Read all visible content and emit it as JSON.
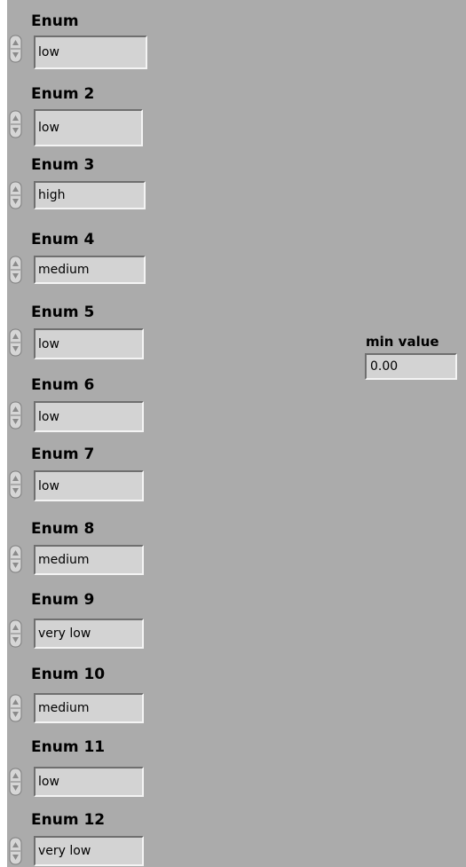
{
  "enums": [
    {
      "label": "Enum",
      "value": "low"
    },
    {
      "label": "Enum 2",
      "value": "low"
    },
    {
      "label": "Enum 3",
      "value": "high"
    },
    {
      "label": "Enum 4",
      "value": "medium"
    },
    {
      "label": "Enum 5",
      "value": "low"
    },
    {
      "label": "Enum 6",
      "value": "low"
    },
    {
      "label": "Enum 7",
      "value": "low"
    },
    {
      "label": "Enum 8",
      "value": "medium"
    },
    {
      "label": "Enum 9",
      "value": "very low"
    },
    {
      "label": "Enum 10",
      "value": "medium"
    },
    {
      "label": "Enum 11",
      "value": "low"
    },
    {
      "label": "Enum 12",
      "value": "very low"
    }
  ],
  "min_value": {
    "label": "min value",
    "value": "0.00"
  },
  "icons": {
    "spinner": "up-down-spinner-icon"
  }
}
